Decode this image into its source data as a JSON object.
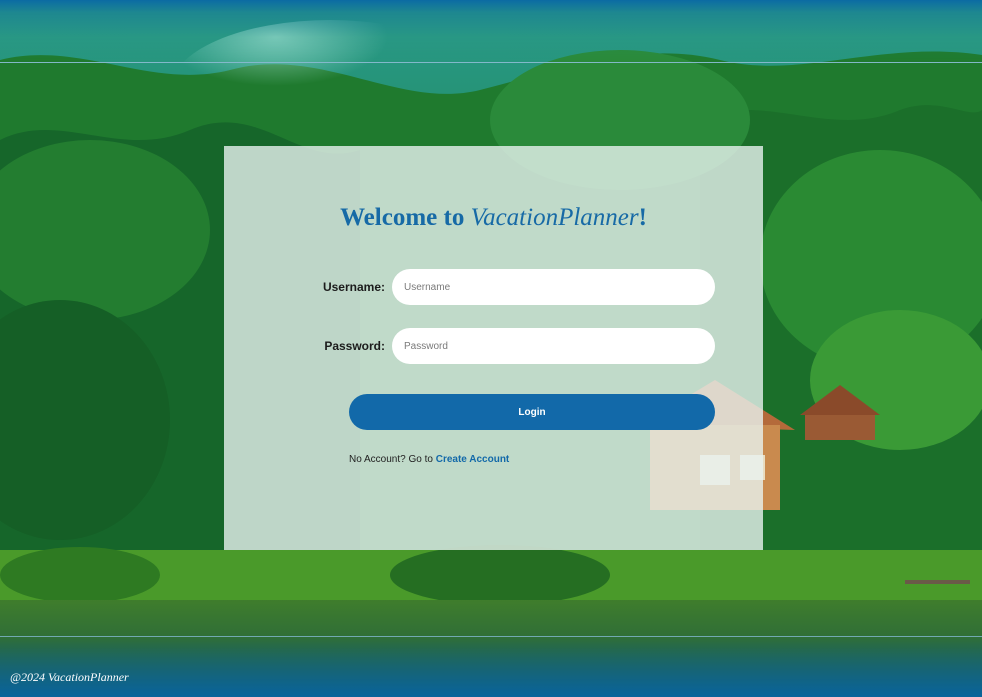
{
  "login": {
    "title_prefix": "Welcome to ",
    "title_brand": "VacationPlanner",
    "title_suffix": "!",
    "username_label": "Username:",
    "username_placeholder": "Username",
    "password_label": "Password:",
    "password_placeholder": "Password",
    "login_button": "Login",
    "no_account_text": "No Account? Go to ",
    "create_account_link": "Create Account"
  },
  "footer": {
    "copyright": "@2024 VacationPlanner"
  },
  "colors": {
    "accent": "#1269a9",
    "title": "#176aa6",
    "card_background": "rgba(232,242,240,0.80)"
  }
}
